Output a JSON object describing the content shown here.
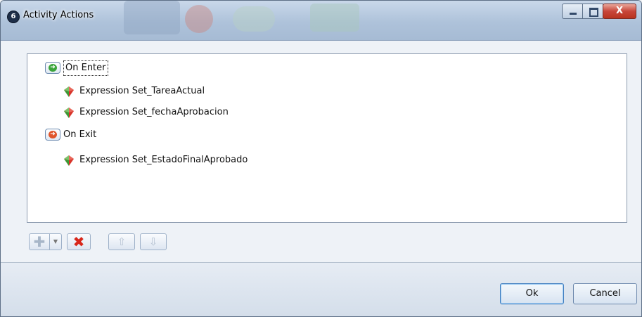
{
  "window": {
    "title": "Activity Actions",
    "app_icon": "6",
    "controls": {
      "minimize": "minimize-icon",
      "maximize": "maximize-icon",
      "close_label": "X"
    }
  },
  "tree": {
    "on_enter": {
      "label": "On Enter",
      "icon": "enter-arrow-icon",
      "items": [
        {
          "label": "Expression Set_TareaActual",
          "icon": "expression-gem-icon"
        },
        {
          "label": "Expression Set_fechaAprobacion",
          "icon": "expression-gem-icon"
        }
      ]
    },
    "on_exit": {
      "label": "On Exit",
      "icon": "exit-arrow-icon",
      "items": [
        {
          "label": "Expression Set_EstadoFinalAprobado",
          "icon": "expression-gem-icon"
        }
      ]
    }
  },
  "toolbar": {
    "add_icon": "plus-icon",
    "dropdown_icon": "chevron-down-icon",
    "delete_icon": "red-x-icon",
    "move_up_icon": "arrow-up-icon",
    "move_down_icon": "arrow-down-icon"
  },
  "footer": {
    "ok_label": "Ok",
    "cancel_label": "Cancel"
  },
  "colors": {
    "accent": "#3f7dbf",
    "close": "#c8463a",
    "enter": "#3aa43a",
    "exit": "#e0552b"
  }
}
